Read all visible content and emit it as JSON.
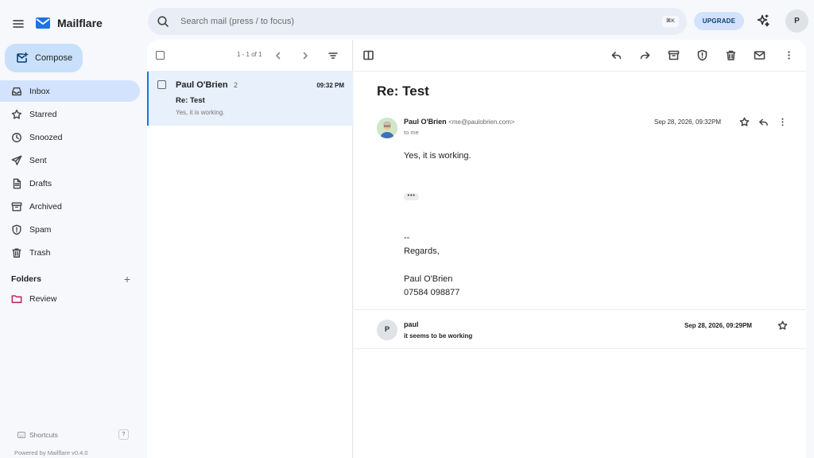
{
  "app": {
    "name": "Mailflare"
  },
  "compose": {
    "label": "Compose"
  },
  "nav": {
    "items": [
      {
        "label": "Inbox",
        "icon": "inbox-icon",
        "active": true
      },
      {
        "label": "Starred",
        "icon": "star-icon"
      },
      {
        "label": "Snoozed",
        "icon": "clock-icon"
      },
      {
        "label": "Sent",
        "icon": "send-icon"
      },
      {
        "label": "Drafts",
        "icon": "draft-icon"
      },
      {
        "label": "Archived",
        "icon": "archive-icon"
      },
      {
        "label": "Spam",
        "icon": "shield-icon"
      },
      {
        "label": "Trash",
        "icon": "trash-icon"
      }
    ]
  },
  "folders": {
    "heading": "Folders",
    "add": "+",
    "items": [
      {
        "label": "Review",
        "color": "#c2185b"
      }
    ]
  },
  "footer": {
    "shortcuts": "Shortcuts",
    "shortcuts_key": "?",
    "powered": "Powered by Mailflare v0.4.0"
  },
  "search": {
    "placeholder": "Search mail (press / to focus)",
    "shortcut": "⌘K"
  },
  "topbar": {
    "upgrade": "UPGRADE",
    "avatar": "P"
  },
  "list": {
    "pager": "1 - 1 of 1",
    "messages": [
      {
        "sender": "Paul O'Brien",
        "count": "2",
        "time": "09:32 PM",
        "subject": "Re: Test",
        "preview": "Yes, it is working."
      }
    ]
  },
  "thread": {
    "title": "Re: Test",
    "message1": {
      "from_name": "Paul O'Brien",
      "from_addr": "<me@paulobrien.com>",
      "to": "to me",
      "date": "Sep 28, 2026, 09:32PM",
      "body_first": "Yes, it is working.",
      "ellipsis": "•••",
      "sig_dash": "--",
      "sig_regards": "Regards,",
      "sig_name": "Paul O'Brien",
      "sig_phone": "07584 098877"
    },
    "message2": {
      "avatar": "P",
      "from_name": "paul",
      "preview": "it seems to be working",
      "date": "Sep 28, 2026, 09:29PM"
    }
  },
  "colors": {
    "accent": "#1a73e8",
    "active_nav": "#d3e3fd",
    "compose_bg": "#c8e0fa",
    "selected_row": "#e8f0fc"
  }
}
